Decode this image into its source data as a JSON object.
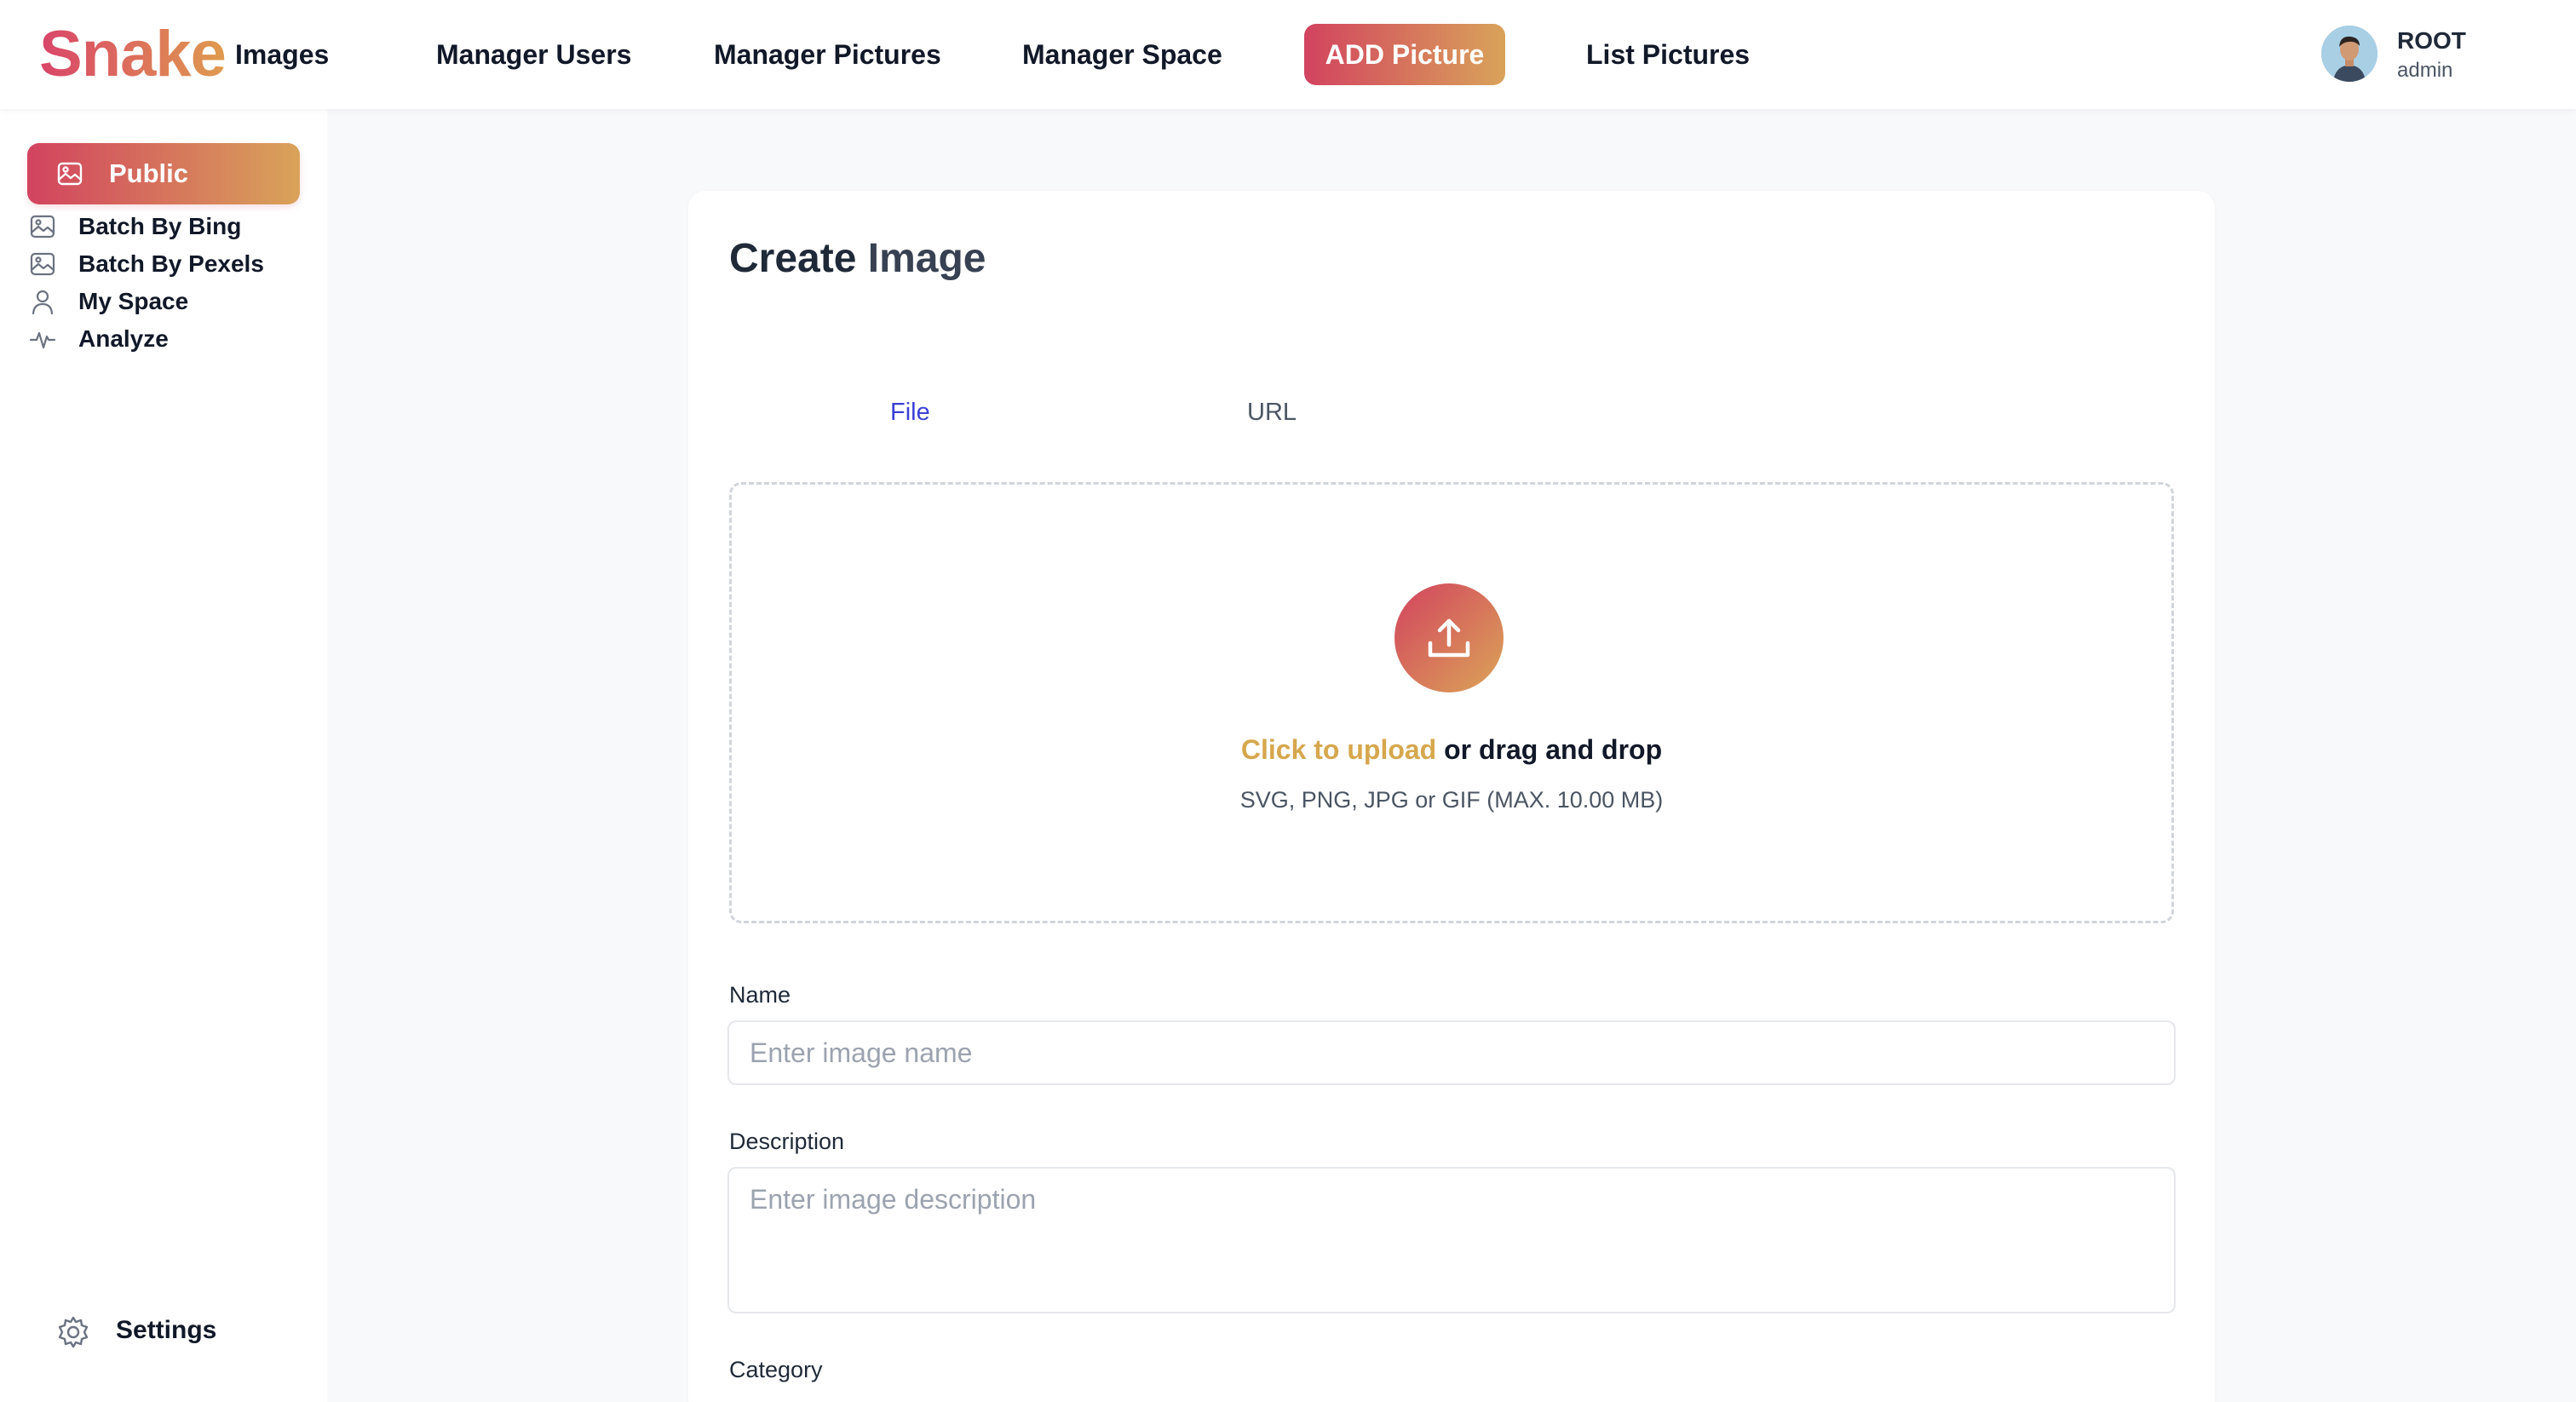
{
  "header": {
    "logo": "Snake",
    "logo_sub": "Images",
    "nav": [
      {
        "label": "Manager Users"
      },
      {
        "label": "Manager Pictures"
      },
      {
        "label": "Manager Space"
      },
      {
        "label": "ADD Picture",
        "active": true
      },
      {
        "label": "List Pictures"
      }
    ],
    "user": {
      "name": "ROOT",
      "role": "admin"
    }
  },
  "sidebar": {
    "items": [
      {
        "label": "Public",
        "icon": "image-icon",
        "active": true
      },
      {
        "label": "Batch By Bing",
        "icon": "image-icon"
      },
      {
        "label": "Batch By Pexels",
        "icon": "image-icon"
      },
      {
        "label": "My Space",
        "icon": "user-icon"
      },
      {
        "label": "Analyze",
        "icon": "activity-icon"
      }
    ],
    "settings_label": "Settings"
  },
  "form": {
    "title_part1": "Create",
    "title_part2": "Image",
    "tabs": [
      {
        "label": "File",
        "active": true
      },
      {
        "label": "URL"
      }
    ],
    "upload": {
      "click_label": "Click to upload",
      "drag_label": "or drag and drop",
      "hint": "SVG, PNG, JPG or GIF (MAX. 10.00 MB)"
    },
    "name": {
      "label": "Name",
      "placeholder": "Enter image name",
      "value": ""
    },
    "description": {
      "label": "Description",
      "placeholder": "Enter image description",
      "value": ""
    },
    "category": {
      "label": "Category"
    }
  },
  "colors": {
    "accent_start": "#d2435f",
    "accent_end": "#d9a35a",
    "tab_active": "#3b3fd6",
    "upload_highlight": "#d6a74d"
  }
}
